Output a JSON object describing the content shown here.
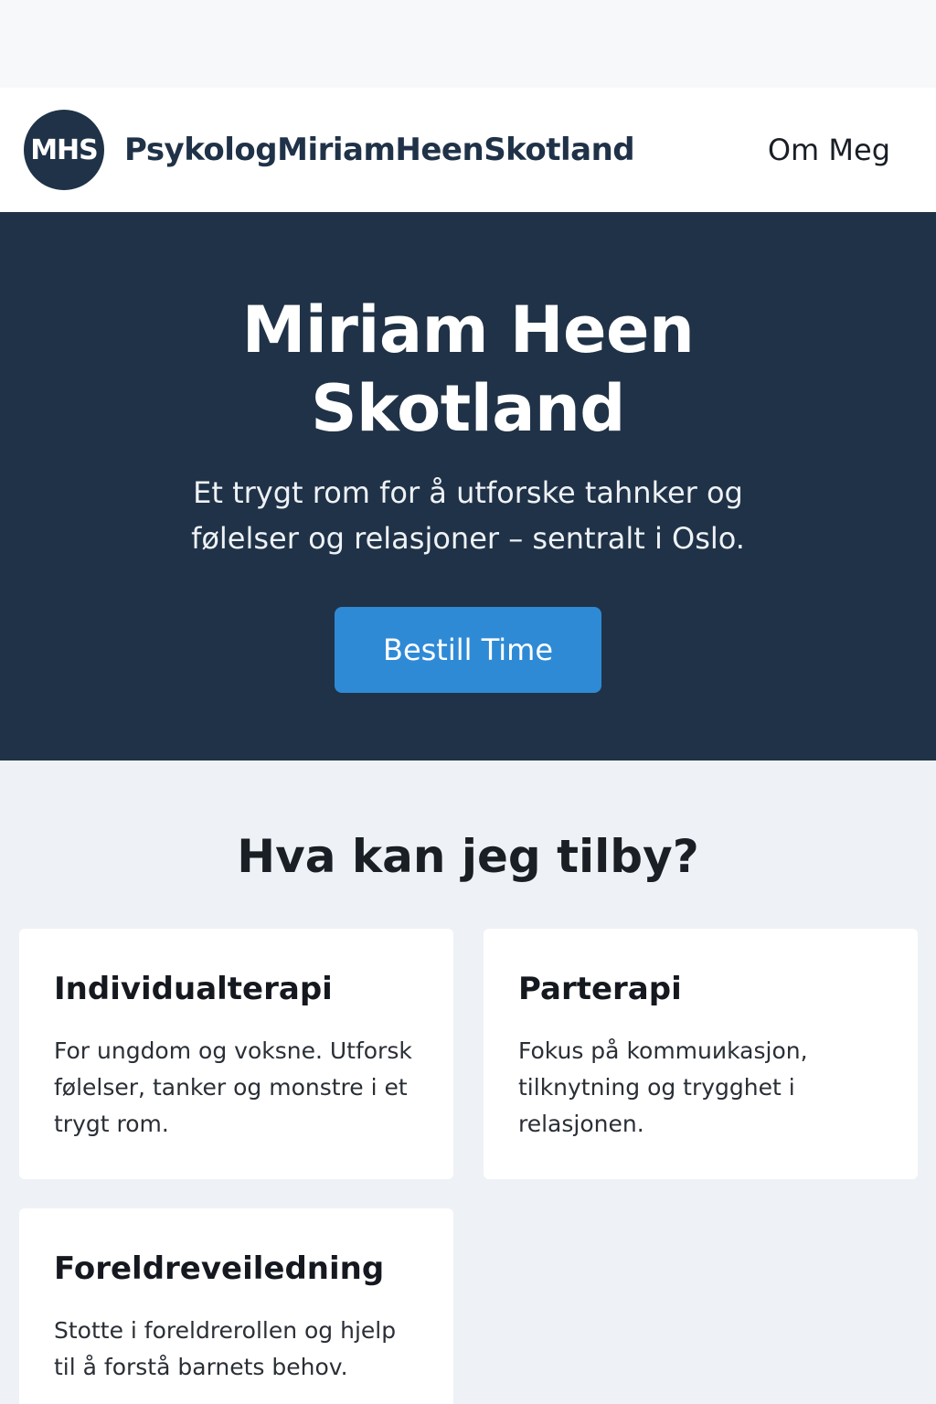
{
  "navbar": {
    "logo_initials": "MHS",
    "site_name": "PsykologMiriamHeenSkotland",
    "links": [
      {
        "label": "Om Meg"
      }
    ]
  },
  "hero": {
    "title": "Miriam Heen Skotland",
    "subtitle": "Et trygt rom for å utforske tahnker og følelser og relasjoner – sentralt i Oslo.",
    "cta_label": "Bestill Time"
  },
  "services": {
    "heading": "Hva kan jeg tilby?",
    "cards": [
      {
        "title": "Individualterapi",
        "text": "For ungdom og voksne. Utforsk følelser, tanker og monstre i et trygt rom."
      },
      {
        "title": "Parterapi",
        "text": "Fokus på kommuиkasjon, tilknytning og trygghet i relasjonen."
      },
      {
        "title": "Foreldreveiledning",
        "text": "Stotte i foreldrerollen og hjelp til å forstå barnets behov."
      }
    ]
  },
  "colors": {
    "navy": "#203247",
    "accent_blue": "#2f8ad6",
    "section_bg": "#eef2f6",
    "card_bg": "#ffffff"
  }
}
